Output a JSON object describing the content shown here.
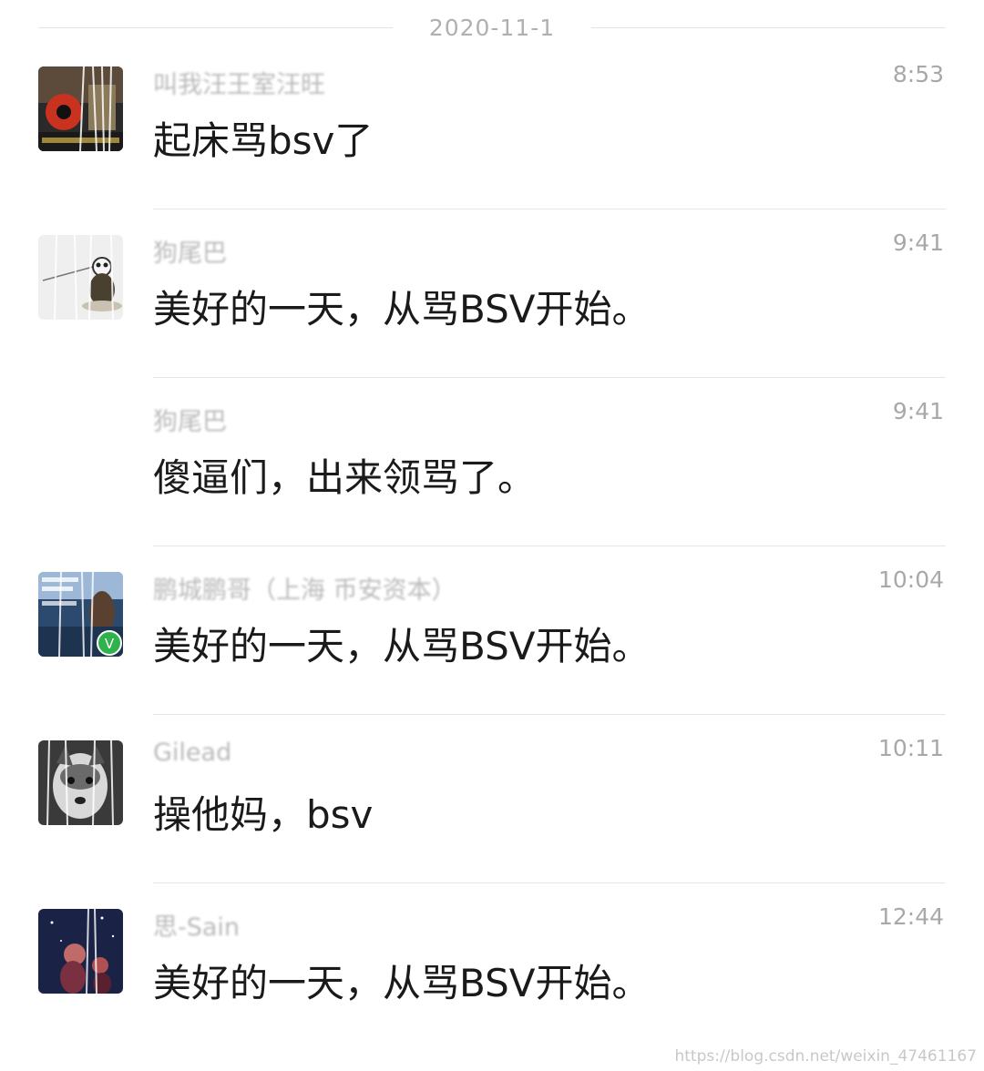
{
  "date_separator": "2020-11-1",
  "messages": [
    {
      "sender": "叫我汪王室汪旺",
      "time": "8:53",
      "text": "起床骂bsv了"
    },
    {
      "sender": "狗尾巴",
      "time": "9:41",
      "text": "美好的一天，从骂BSV开始。"
    },
    {
      "sender": "狗尾巴",
      "time": "9:41",
      "text": "傻逼们，出来领骂了。"
    },
    {
      "sender": "鹏城鹏哥（上海 币安资本）",
      "time": "10:04",
      "text": "美好的一天，从骂BSV开始。"
    },
    {
      "sender": "Gilead",
      "time": "10:11",
      "text": "操他妈，bsv"
    },
    {
      "sender": "思-Sain",
      "time": "12:44",
      "text": "美好的一天，从骂BSV开始。"
    }
  ],
  "watermark": "https://blog.csdn.net/weixin_47461167",
  "colors": {
    "background": "#ffffff",
    "meta_text": "#a8a8a8",
    "message_text": "#1a1a1a",
    "divider": "#e6e6e6",
    "badge_green": "#2fb24b"
  }
}
